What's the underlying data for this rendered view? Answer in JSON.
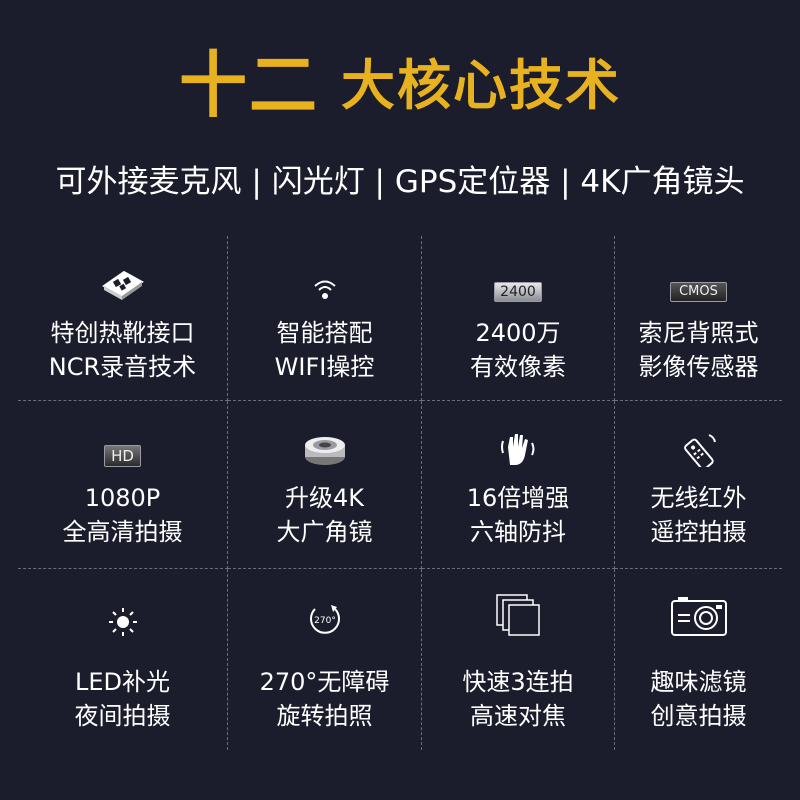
{
  "header": {
    "title_number": "十二",
    "title_rest": "大核心技术",
    "subtitle": "可外接麦克风 | 闪光灯 | GPS定位器 | 4K广角镜头",
    "title_color": "#e7b11f",
    "background": "#1b1c2c"
  },
  "features": [
    {
      "icon": "hot-shoe-icon",
      "line1": "特创热靴接口",
      "line2": "NCR录音技术"
    },
    {
      "icon": "wifi-icon",
      "line1": "智能搭配",
      "line2": "WIFI操控"
    },
    {
      "icon": "megapixel-badge-icon",
      "icon_text": "2400",
      "line1": "2400万",
      "line2": "有效像素"
    },
    {
      "icon": "cmos-sensor-icon",
      "icon_text": "CMOS",
      "line1": "索尼背照式",
      "line2": "影像传感器"
    },
    {
      "icon": "hd-badge-icon",
      "icon_text": "HD",
      "line1": "1080P",
      "line2": "全高清拍摄"
    },
    {
      "icon": "wide-angle-lens-icon",
      "line1": "升级4K",
      "line2": "大广角镜"
    },
    {
      "icon": "shaking-hand-icon",
      "line1": "16倍增强",
      "line2": "六轴防抖"
    },
    {
      "icon": "remote-control-icon",
      "line1": "无线红外",
      "line2": "遥控拍摄"
    },
    {
      "icon": "sun-light-icon",
      "line1": "LED补光",
      "line2": "夜间拍摄"
    },
    {
      "icon": "rotate-270-icon",
      "icon_text": "270°",
      "line1": "270°无障碍",
      "line2": "旋转拍照"
    },
    {
      "icon": "burst-frames-icon",
      "line1": "快速3连拍",
      "line2": "高速对焦"
    },
    {
      "icon": "camera-icon",
      "line1": "趣味滤镜",
      "line2": "创意拍摄"
    }
  ]
}
